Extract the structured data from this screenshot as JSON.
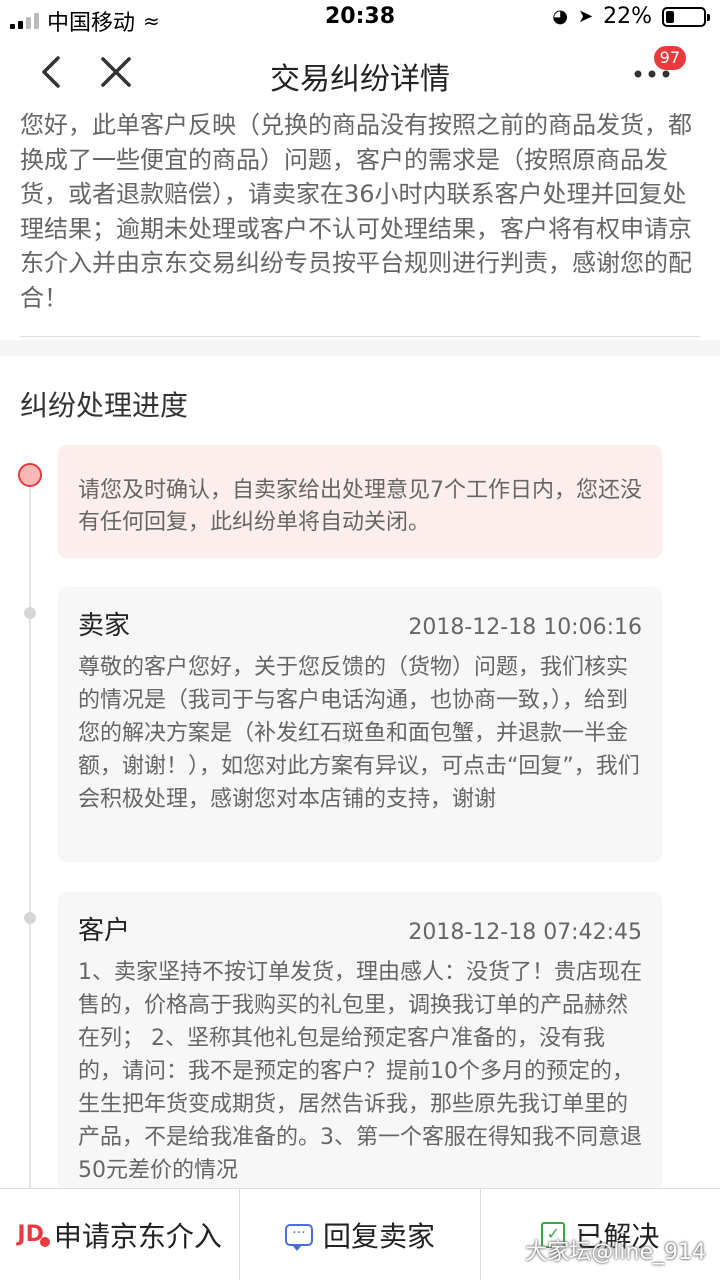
{
  "status_bar": {
    "carrier": "中国移动",
    "time": "20:38",
    "battery_percent": "22%",
    "battery_level": 0.22
  },
  "nav": {
    "title": "交易纠纷详情",
    "badge_count": "97"
  },
  "intro": {
    "text": "您好，此单客户反映（兑换的商品没有按照之前的商品发货，都换成了一些便宜的商品）问题，客户的需求是（按照原商品发货，或者退款赔偿），请卖家在36小时内联系客户处理并回复处理结果；逾期未处理或客户不认可处理结果，客户将有权申请京东介入并由京东交易纠纷专员按平台规则进行判责，感谢您的配合！"
  },
  "progress": {
    "title": "纠纷处理进度",
    "notice": "请您及时确认，自卖家给出处理意见7个工作日内，您还没有任何回复，此纠纷单将自动关闭。",
    "messages": [
      {
        "role": "卖家",
        "time": "2018-12-18 10:06:16",
        "body": "尊敬的客户您好，关于您反馈的（货物）问题，我们核实的情况是（我司于与客户电话沟通，也协商一致，），给到您的解决方案是（补发红石斑鱼和面包蟹，并退款一半金额，谢谢！），如您对此方案有异议，可点击“回复”，我们会积极处理，感谢您对本店铺的支持，谢谢"
      },
      {
        "role": "客户",
        "time": "2018-12-18 07:42:45",
        "body": "1、卖家坚持不按订单发货，理由感人：没货了！贵店现在售的，价格高于我购买的礼包里，调换我订单的产品赫然在列； 2、坚称其他礼包是给预定客户准备的，没有我的，请问：我不是预定的客户？提前10个多月的预定的，生生把年货变成期货，居然告诉我，那些原先我订单里的产品，不是给我准备的。3、第一个客服在得知我不同意退50元差价的情况"
      }
    ]
  },
  "bottom_bar": {
    "jd_label": "申请京东介入",
    "reply_label": "回复卖家",
    "resolved_label": "已解决"
  },
  "watermark": "大家坛@line_914",
  "colors": {
    "accent_red": "#e93b3d",
    "chat_blue": "#4a6fd8",
    "done_green": "#3aa64a"
  },
  "icons": {
    "back": "chevron-left-icon",
    "close": "close-icon",
    "more": "more-dots-icon",
    "jd": "jd-logo-icon",
    "reply": "chat-bubble-icon",
    "resolved": "document-check-icon"
  }
}
